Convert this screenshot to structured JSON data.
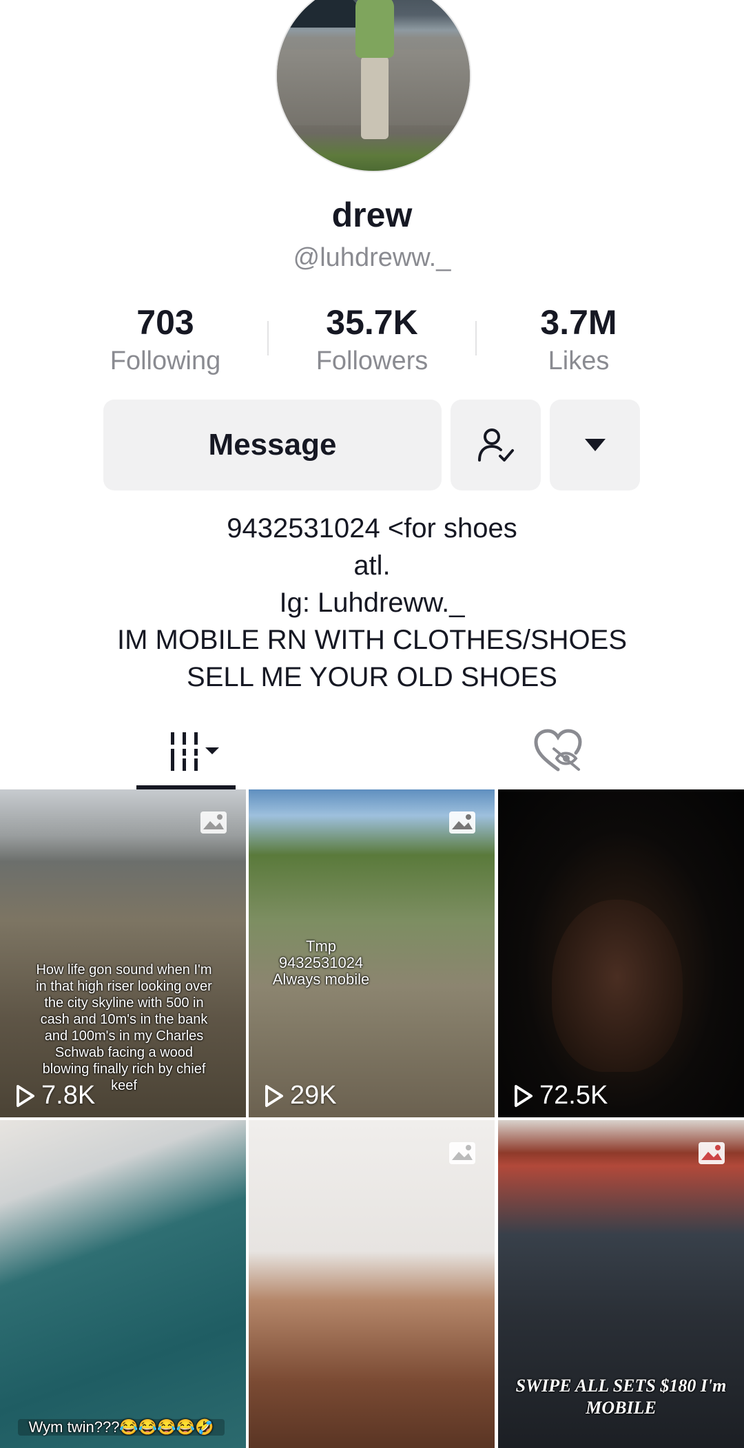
{
  "profile": {
    "display_name": "drew",
    "handle": "@luhdreww._",
    "avatar_icon": "profile-photo"
  },
  "stats": [
    {
      "value": "703",
      "label": "Following"
    },
    {
      "value": "35.7K",
      "label": "Followers"
    },
    {
      "value": "3.7M",
      "label": "Likes"
    }
  ],
  "actions": {
    "message_label": "Message",
    "follow_icon": "user-check-icon",
    "more_icon": "caret-down-icon"
  },
  "bio": [
    "9432531024 <for shoes",
    "atl.",
    "Ig: Luhdreww._",
    "IM MOBILE RN WITH CLOTHES/SHOES",
    "SELL ME YOUR OLD SHOES"
  ],
  "tabs": {
    "videos_icon": "grid-columns-icon",
    "liked_icon": "hidden-heart-icon"
  },
  "videos": [
    {
      "views": "7.8K",
      "caption": "How life gon sound when I'm in that high riser looking over the city skyline with 500 in cash and 10m's in the bank and 100m's in my Charles Schwab facing a wood blowing finally rich by chief keef",
      "is_photo": true
    },
    {
      "views": "29K",
      "caption": "Tmp 9432531024 Always mobile",
      "is_photo": true
    },
    {
      "views": "72.5K",
      "caption": "",
      "is_photo": false
    },
    {
      "views": "",
      "caption": "Wym twin???😂😂😂😂🤣",
      "is_photo": false
    },
    {
      "views": "",
      "caption": "",
      "is_photo": true
    },
    {
      "views": "",
      "caption": "SWIPE ALL SETS $180 I'm MOBILE",
      "is_photo": true
    }
  ],
  "colors": {
    "text_primary": "#161823",
    "text_secondary": "#8a8b91",
    "button_bg": "#f1f1f2"
  }
}
